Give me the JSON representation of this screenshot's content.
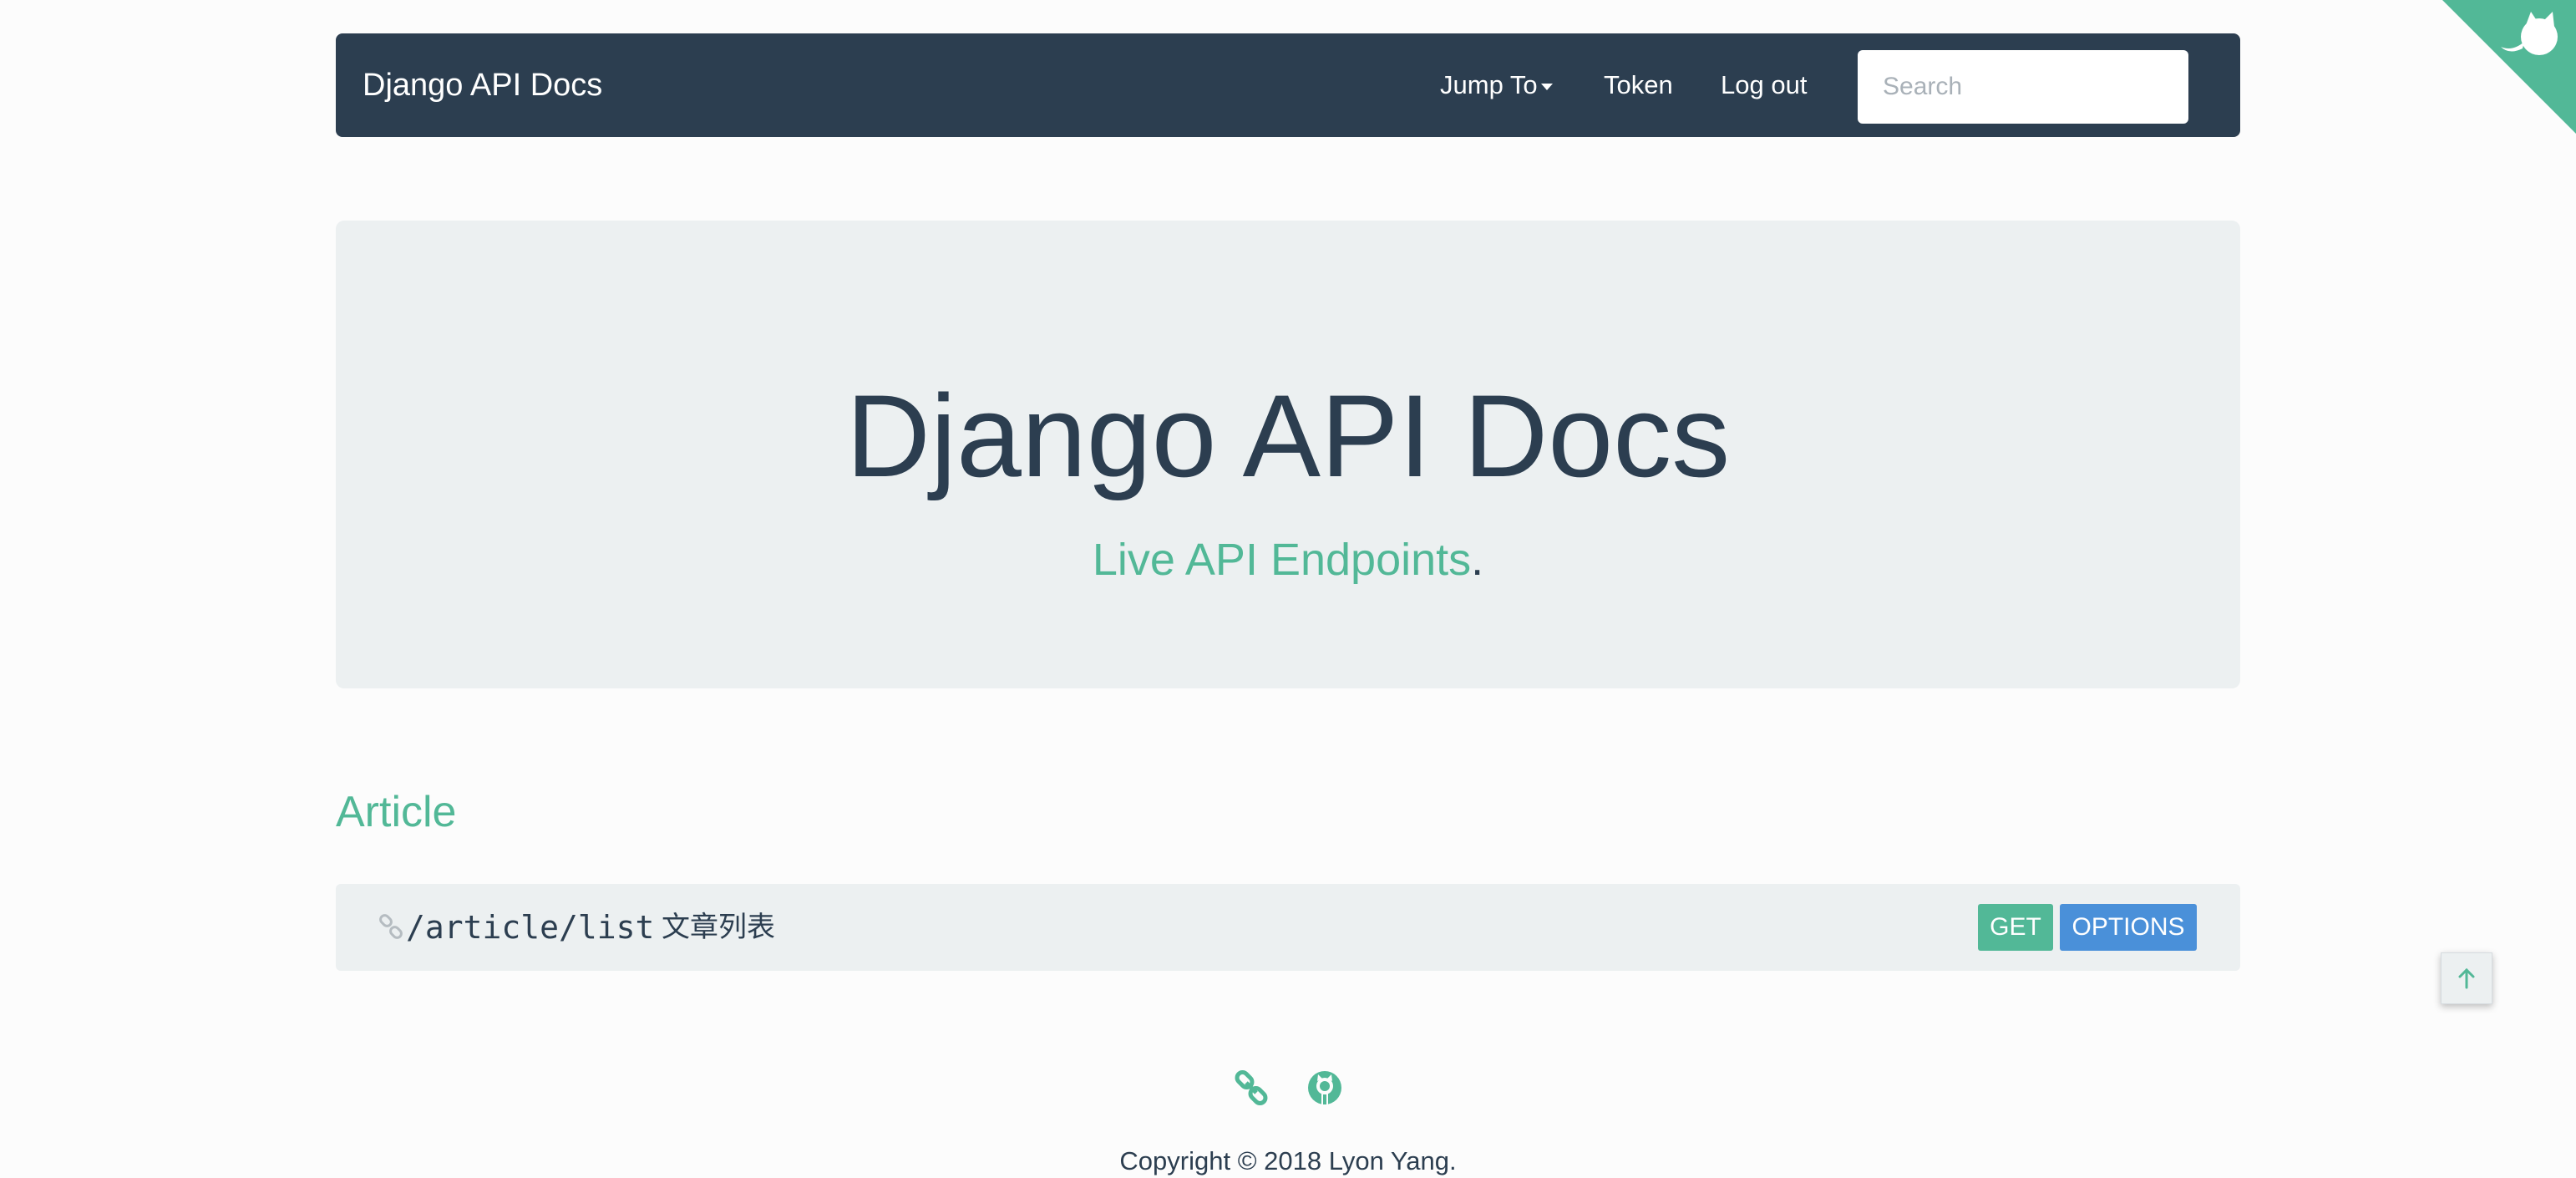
{
  "colors": {
    "navbar_bg": "#2c3e50",
    "accent": "#52b897",
    "options_badge": "#4a90d9",
    "panel_bg": "#ecf0f1"
  },
  "navbar": {
    "brand": "Django API Docs",
    "jump_to": "Jump To",
    "token": "Token",
    "logout": "Log out",
    "search_placeholder": "Search"
  },
  "hero": {
    "title": "Django API Docs",
    "subtitle_highlight": "Live API Endpoints",
    "subtitle_suffix": "."
  },
  "sections": [
    {
      "title": "Article",
      "endpoints": [
        {
          "path": "/article/list",
          "description": "文章列表",
          "methods": [
            "GET",
            "OPTIONS"
          ]
        }
      ]
    }
  ],
  "footer": {
    "icons": [
      "link-icon",
      "github-icon"
    ],
    "copyright": "Copyright © 2018 Lyon Yang."
  },
  "icons": {
    "corner": "github-octocat-icon",
    "back_to_top": "arrow-up-icon",
    "endpoint": "link-icon"
  }
}
